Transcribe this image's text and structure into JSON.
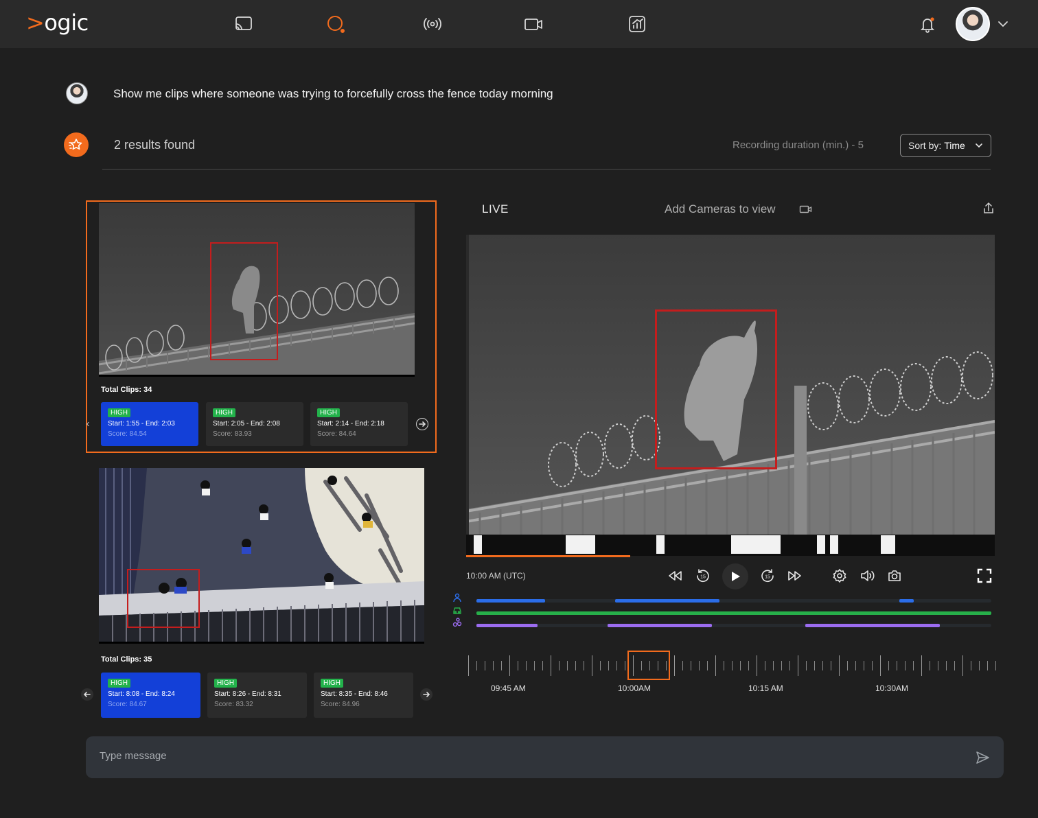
{
  "app": {
    "logo_chevron": ">",
    "logo_text": "ogic",
    "accent_color": "#f26b1d"
  },
  "nav": {
    "items": [
      {
        "icon": "cast-icon",
        "active": false
      },
      {
        "icon": "search-chat-icon",
        "active": true
      },
      {
        "icon": "broadcast-icon",
        "active": false
      },
      {
        "icon": "video-camera-icon",
        "active": false
      },
      {
        "icon": "analytics-icon",
        "active": false
      }
    ]
  },
  "query": {
    "text": "Show me clips where someone was trying to forcefully cross the fence today morning"
  },
  "results": {
    "count_text": "2 results found",
    "recording_duration": "Recording duration (min.) - 5",
    "sort_prefix": "Sort by:",
    "sort_value": "Time",
    "cards": [
      {
        "total_clips": "Total Clips: 34",
        "clips": [
          {
            "badge": "HIGH",
            "range": "Start: 1:55 - End: 2:03",
            "score": "Score: 84.54",
            "active": true
          },
          {
            "badge": "HIGH",
            "range": "Start: 2:05 - End: 2:08",
            "score": "Score: 83.93",
            "active": false
          },
          {
            "badge": "HIGH",
            "range": "Start: 2:14 - End: 2:18",
            "score": "Score: 84.64",
            "active": false
          }
        ]
      },
      {
        "total_clips": "Total Clips: 35",
        "clips": [
          {
            "badge": "HIGH",
            "range": "Start: 8:08 - End: 8:24",
            "score": "Score: 84.67",
            "active": true
          },
          {
            "badge": "HIGH",
            "range": "Start: 8:26 - End: 8:31",
            "score": "Score: 83.32",
            "active": false
          },
          {
            "badge": "HIGH",
            "range": "Start: 8:35 - End: 8:46",
            "score": "Score: 84.96",
            "active": false
          }
        ]
      }
    ]
  },
  "player": {
    "live_label": "LIVE",
    "add_cameras_label": "Add Cameras to view",
    "current_time": "10:00 AM (UTC)",
    "timeline_labels": [
      "09:45 AM",
      "10:00AM",
      "10:15 AM",
      "10:30AM"
    ],
    "tracks": [
      {
        "name": "person",
        "color": "#2b6de8"
      },
      {
        "name": "vehicle",
        "color": "#27b04a"
      },
      {
        "name": "other",
        "color": "#9b6cf0"
      }
    ]
  },
  "composer": {
    "placeholder": "Type message"
  }
}
